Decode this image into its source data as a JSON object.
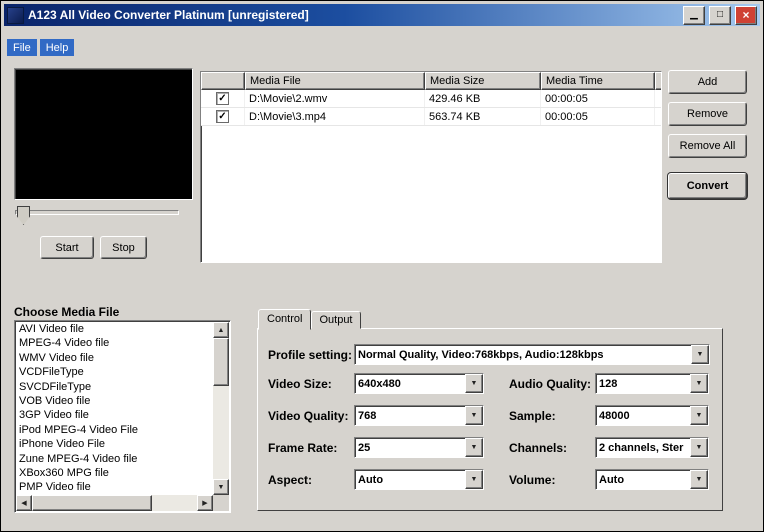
{
  "window": {
    "title": "A123 All Video Converter Platinum  [unregistered]"
  },
  "icons": {
    "minimize": "▁",
    "maximize": "□",
    "close": "×",
    "dropdown": "▼",
    "scroll_up": "▲",
    "scroll_down": "▼",
    "scroll_left": "◀",
    "scroll_right": "▶",
    "check": "✓"
  },
  "menu": {
    "file": "File",
    "help": "Help"
  },
  "transport": {
    "start": "Start",
    "stop": "Stop"
  },
  "queue": {
    "columns": {
      "check": "",
      "file": "Media File",
      "size": "Media Size",
      "time": "Media Time"
    },
    "rows": [
      {
        "check": "✓",
        "file": "D:\\Movie\\2.wmv",
        "size": "429.46 KB",
        "time": "00:00:05"
      },
      {
        "check": "✓",
        "file": "D:\\Movie\\3.mp4",
        "size": "563.74 KB",
        "time": "00:00:05"
      }
    ]
  },
  "actions": {
    "add": "Add",
    "remove": "Remove",
    "remove_all": "Remove All",
    "convert": "Convert"
  },
  "media_types": {
    "label": "Choose Media File",
    "items": [
      "AVI Video file",
      "MPEG-4 Video file",
      "WMV Video file",
      "VCDFileType",
      "SVCDFileType",
      "VOB Video file",
      "3GP Video file",
      "iPod MPEG-4 Video File",
      "iPhone Video File",
      "Zune MPEG-4 Video file",
      "XBox360 MPG file",
      "PMP Video file"
    ]
  },
  "tabs": {
    "control": "Control",
    "output": "Output"
  },
  "control_tab": {
    "profile": {
      "label": "Profile setting:",
      "value": "Normal Quality, Video:768kbps, Audio:128kbps"
    },
    "left": [
      {
        "label": "Video Size:",
        "value": "640x480"
      },
      {
        "label": "Video Quality:",
        "value": "768"
      },
      {
        "label": "Frame Rate:",
        "value": "25"
      },
      {
        "label": "Aspect:",
        "value": "Auto"
      }
    ],
    "right": [
      {
        "label": "Audio Quality:",
        "value": "128"
      },
      {
        "label": "Sample:",
        "value": "48000"
      },
      {
        "label": "Channels:",
        "value": "2 channels, Ster"
      },
      {
        "label": "Volume:",
        "value": "Auto"
      }
    ]
  },
  "colors": {
    "titlebar_left": "#0a246a",
    "titlebar_right": "#a6caf0",
    "menu_highlight": "#316ac5",
    "window_bg": "#d6d3ce",
    "close_button": "#cf4234"
  }
}
